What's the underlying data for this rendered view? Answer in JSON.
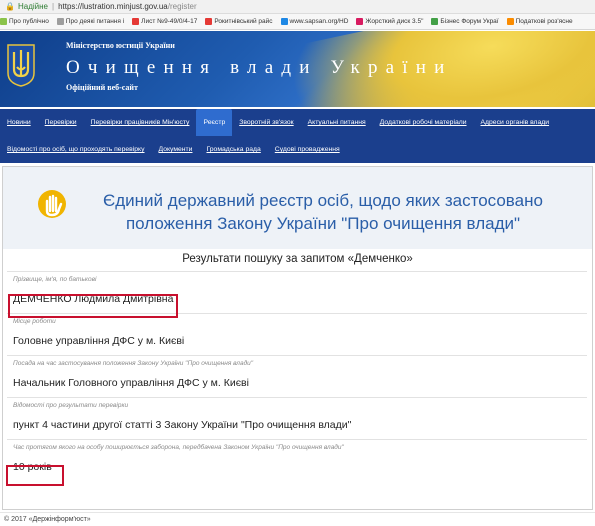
{
  "browser": {
    "secure_label": "Надійне",
    "url_host": "https://lustration.minjust.gov.ua",
    "url_path": "/register",
    "bookmarks": [
      {
        "label": "Про публічно",
        "color": "#8bc34a"
      },
      {
        "label": "Про деякі питання і",
        "color": "#9e9e9e"
      },
      {
        "label": "Лист №9-49/0/4-17",
        "color": "#e53935"
      },
      {
        "label": "Рокитнівський райс",
        "color": "#e53935"
      },
      {
        "label": "www.sapsan.org/HD",
        "color": "#1e88e5"
      },
      {
        "label": "Жорсткий диск 3.5\"",
        "color": "#d81b60"
      },
      {
        "label": "Бізнес Форум Украї",
        "color": "#43a047"
      },
      {
        "label": "Податкові роз'ясне",
        "color": "#fb8c00"
      }
    ]
  },
  "header": {
    "ministry": "Міністерство юстиції України",
    "title": "Очищення влади України",
    "subtitle": "Офіційний веб-сайт"
  },
  "nav": {
    "row1": [
      {
        "label": "Новини",
        "name": "nav-news",
        "active": false
      },
      {
        "label": "Перевірки",
        "name": "nav-checks",
        "active": false
      },
      {
        "label": "Перевірки працівників Мін'юсту",
        "name": "nav-minjust-checks",
        "active": false
      },
      {
        "label": "Реєстр",
        "name": "nav-register",
        "active": true
      },
      {
        "label": "Зворотній зв'язок",
        "name": "nav-feedback",
        "active": false
      },
      {
        "label": "Актуальні питання",
        "name": "nav-topical",
        "active": false
      },
      {
        "label": "Додаткові робочі матеріали",
        "name": "nav-materials",
        "active": false
      },
      {
        "label": "Адреси органів влади",
        "name": "nav-addresses",
        "active": false
      }
    ],
    "row2": [
      {
        "label": "Відомості про осіб, що проходять перевірку",
        "name": "nav-persons-info",
        "active": false
      },
      {
        "label": "Документи",
        "name": "nav-documents",
        "active": false
      },
      {
        "label": "Громадська рада",
        "name": "nav-public-council",
        "active": false
      },
      {
        "label": "Судові провадження",
        "name": "nav-court",
        "active": false
      }
    ]
  },
  "register": {
    "title": "Єдиний державний реєстр осіб, щодо яких застосовано положення Закону України \"Про очищення влади\"",
    "results_title": "Результати пошуку за запитом «Демченко»",
    "fields": [
      {
        "label": "Прізвище, ім'я, по батькові",
        "value": "ДЕМЧЕНКО Людмила Дмитрівна"
      },
      {
        "label": "Місце роботи",
        "value": "Головне управління ДФС у м. Києві"
      },
      {
        "label": "Посада на час застосування положення Закону України \"Про очищення влади\"",
        "value": "Начальник Головного управління ДФС у м. Києві"
      },
      {
        "label": "Відомості про результати перевірки",
        "value": "пункт 4 частини другої статті 3 Закону України \"Про очищення влади\""
      },
      {
        "label": "Час протягом якого на особу поширюється заборона, передбачена Законом України \"Про очищення влади\"",
        "value": "10 років"
      }
    ]
  },
  "footer": {
    "copyright": "© 2017 «Держінформ'юст»"
  },
  "colors": {
    "nav_bg": "#1b3f8d",
    "nav_active": "#2f6ccf",
    "banner_text": "#2a5ea8",
    "highlight": "#c8102e"
  }
}
